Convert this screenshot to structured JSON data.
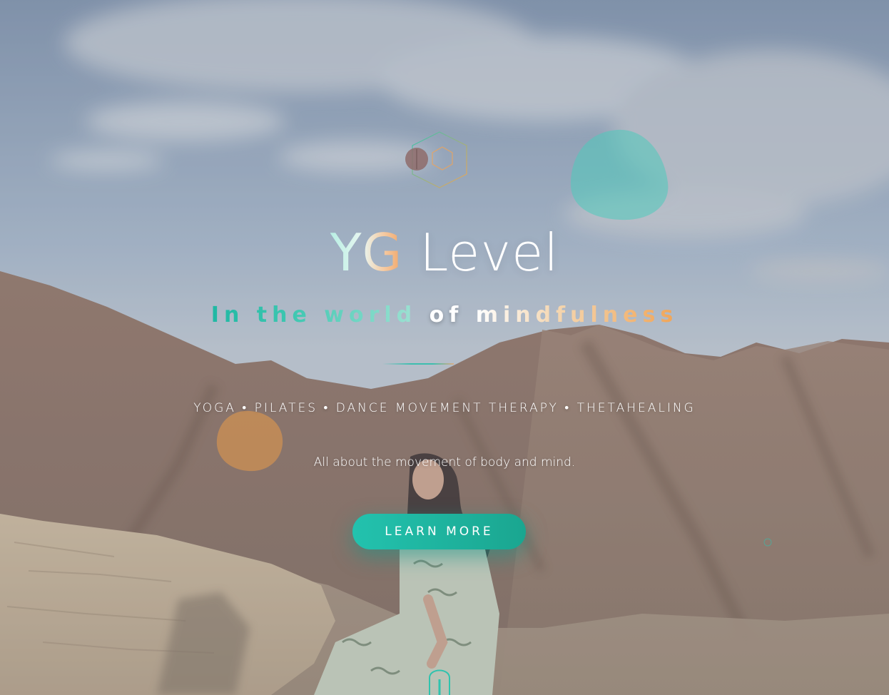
{
  "hero": {
    "brand_first": "YG",
    "brand_second": "Level",
    "tagline": {
      "part1": "In the world",
      "part2": "of",
      "part3": "mindfulness"
    },
    "services": "YOGA • PILATES • DANCE MOVEMENT THERAPY • THETAHEALING",
    "subtitle": "All about the movement of body and mind.",
    "cta_label": "LEARN MORE"
  },
  "decor": {
    "logo_icon": "hexagon-logo-icon",
    "blob_teal": "teal-blob",
    "blob_orange": "orange-blob"
  },
  "colors": {
    "accent_teal": "#1fb8a3",
    "accent_orange": "#f0a456",
    "text": "#ffffff"
  }
}
